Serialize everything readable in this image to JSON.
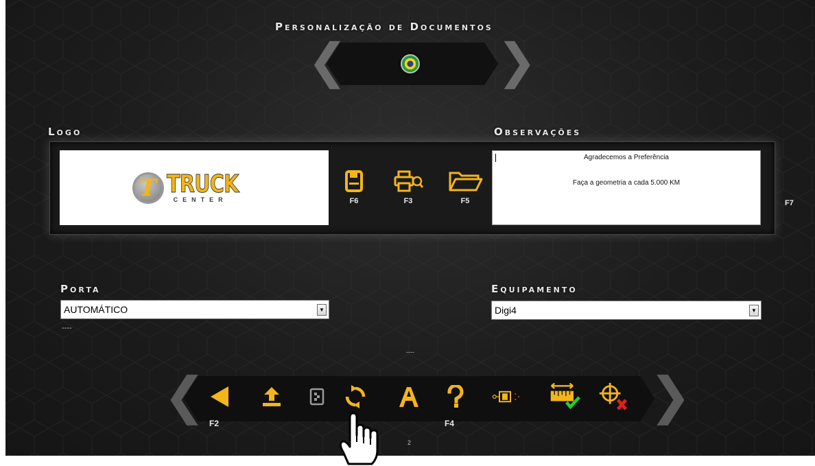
{
  "header": {
    "title": "Personalização de Documentos"
  },
  "language": {
    "icon": "brazil-flag-icon"
  },
  "logo_section": {
    "title": "Logo",
    "logo": {
      "name_big": "TRUCK",
      "name_small": "CENTER",
      "initial": "T"
    }
  },
  "observations_section": {
    "title": "Observações",
    "line1": "Agradecemos a Preferência",
    "line2": "Faça a geometria a cada 5.000 KM",
    "side_key": "F7"
  },
  "doc_tools": [
    {
      "icon": "save-icon",
      "key": "F6"
    },
    {
      "icon": "print-preview-icon",
      "key": "F3"
    },
    {
      "icon": "open-folder-icon",
      "key": "F5"
    }
  ],
  "porta": {
    "label": "Porta",
    "value": "AUTOMÁTICO",
    "status": "----"
  },
  "equipamento": {
    "label": "Equipamento",
    "value": "Digi4"
  },
  "center_status": "----",
  "toolbar": {
    "items": [
      {
        "icon": "back-arrow-icon",
        "key": "F2"
      },
      {
        "icon": "upload-icon",
        "key": ""
      },
      {
        "icon": "document-icon",
        "key": ""
      },
      {
        "icon": "refresh-icon",
        "key": ""
      },
      {
        "icon": "font-icon",
        "key": ""
      },
      {
        "icon": "help-icon",
        "key": "F4"
      },
      {
        "icon": "sensor-icon",
        "key": ""
      },
      {
        "icon": "ruler-check-icon",
        "key": ""
      },
      {
        "icon": "target-cancel-icon",
        "key": ""
      }
    ],
    "page_indicator": "2"
  },
  "colors": {
    "accent": "#f3b51a",
    "background": "#1c1c1c",
    "check": "#1fcf3a",
    "cancel": "#e0201a"
  }
}
